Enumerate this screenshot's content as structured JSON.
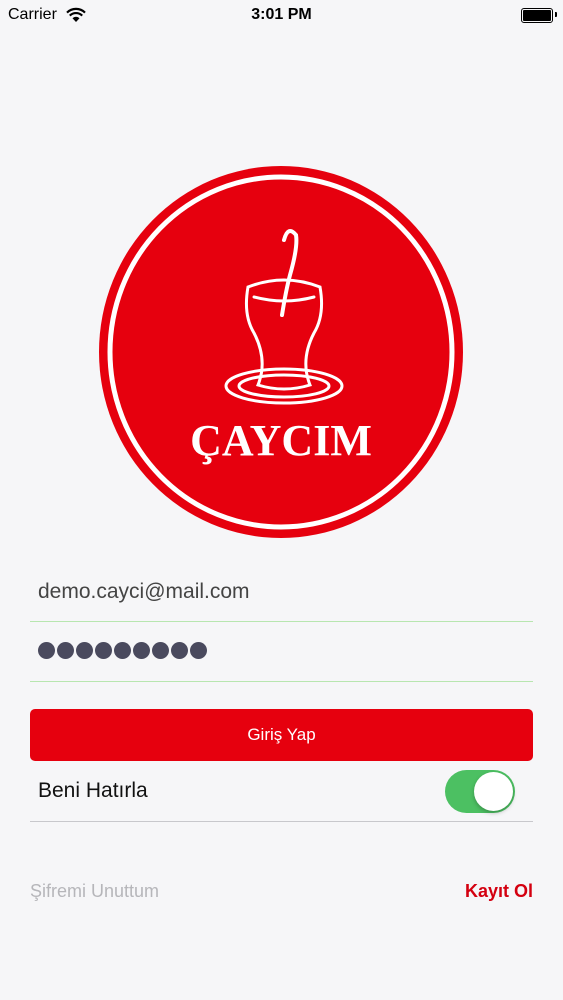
{
  "status_bar": {
    "carrier": "Carrier",
    "time": "3:01 PM"
  },
  "logo": {
    "brand_text": "ÇAYCIM",
    "icon": "tea-glass-icon",
    "colors": {
      "background": "#e6000e",
      "ring": "#ffffff"
    }
  },
  "form": {
    "email_value": "demo.cayci@mail.com",
    "password_mask_count": 9,
    "login_label": "Giriş Yap",
    "remember_label": "Beni Hatırla",
    "remember_on": true,
    "forgot_label": "Şifremi Unuttum",
    "register_label": "Kayıt Ol"
  },
  "colors": {
    "accent": "#e6000e",
    "toggle_on": "#4cc062",
    "field_underline": "#b8e6b0"
  }
}
